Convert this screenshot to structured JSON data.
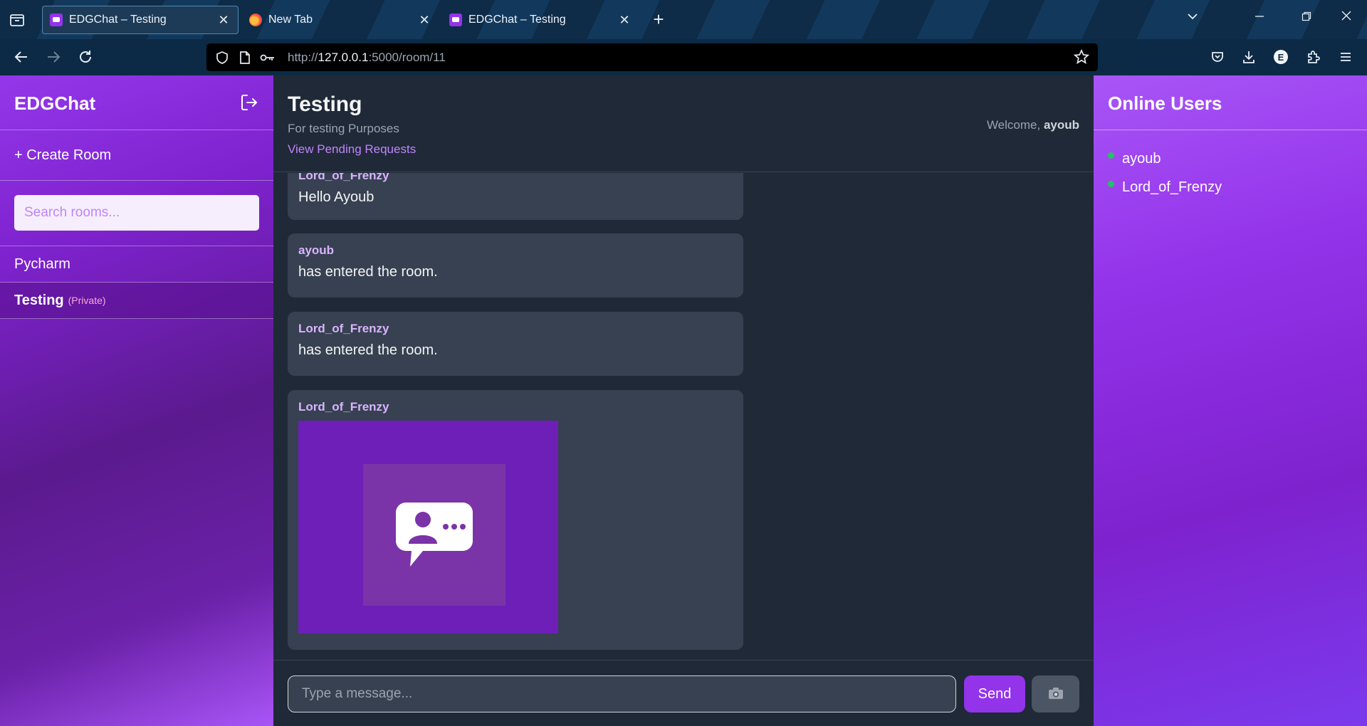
{
  "browser": {
    "tabs": [
      {
        "title": "EDGChat – Testing",
        "favicon": "edgchat-icon",
        "active": true
      },
      {
        "title": "New Tab",
        "favicon": "firefox-icon",
        "active": false
      },
      {
        "title": "EDGChat – Testing",
        "favicon": "edgchat-icon",
        "active": false
      }
    ],
    "url": {
      "scheme": "http://",
      "host": "127.0.0.1",
      "path": ":5000/room/11"
    },
    "account_initial": "E"
  },
  "sidebar": {
    "brand": "EDGChat",
    "create_room": "+ Create Room",
    "search_placeholder": "Search rooms...",
    "rooms": [
      {
        "name": "Pycharm",
        "tag": "",
        "active": false
      },
      {
        "name": "Testing",
        "tag": "(Private)",
        "active": true
      }
    ]
  },
  "chat": {
    "room_title": "Testing",
    "room_description": "For testing Purposes",
    "pending_link": "View Pending Requests",
    "welcome_prefix": "Welcome,",
    "username": "ayoub",
    "messages": [
      {
        "author": "Lord_of_Frenzy",
        "text": "Hello Ayoub"
      },
      {
        "author": "ayoub",
        "text": "has entered the room."
      },
      {
        "author": "Lord_of_Frenzy",
        "text": "has entered the room."
      },
      {
        "author": "Lord_of_Frenzy",
        "image": "chat-user-icon"
      }
    ],
    "input_placeholder": "Type a message...",
    "send_label": "Send",
    "upload_icon": "camera-icon"
  },
  "online": {
    "title": "Online Users",
    "users": [
      "ayoub",
      "Lord_of_Frenzy"
    ]
  },
  "colors": {
    "accent": "#9333ea",
    "online_dot": "#22c55e",
    "author": "#d8b4fe",
    "private_tag": "#f9a8d4"
  }
}
